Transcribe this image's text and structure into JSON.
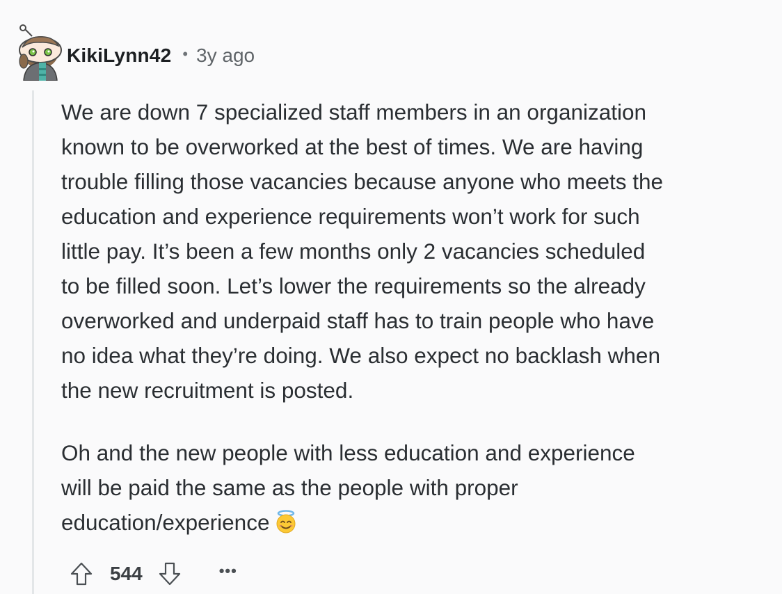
{
  "comment": {
    "author": "KikiLynn42",
    "separator": "•",
    "age": "3y ago",
    "paragraphs": [
      "We are down 7 specialized staff members in an organization\nknown to be overworked at the best of times. We are having\ntrouble filling those vacancies because anyone who meets the\neducation and experience requirements won’t work for such\nlittle pay. It’s been a few months only 2 vacancies scheduled\nto be filled soon. Let’s lower the requirements so the already\noverworked and underpaid staff has to train people who have\nno idea what they’re doing. We also expect no backlash when\nthe new recruitment is posted.",
      "Oh and the new people with less education and experience\nwill be paid the same as the people with proper\neducation/experience"
    ],
    "emoji": "smiling-face-with-halo-icon",
    "score": "544",
    "more_label": "•••"
  },
  "icons": {
    "upvote": "upvote-arrow-icon",
    "downvote": "downvote-arrow-icon",
    "avatar": "user-avatar"
  },
  "colors": {
    "background": "#fafafb",
    "text": "#2a2e32",
    "muted": "#5f6468",
    "thread_line": "#e3e6e8"
  }
}
